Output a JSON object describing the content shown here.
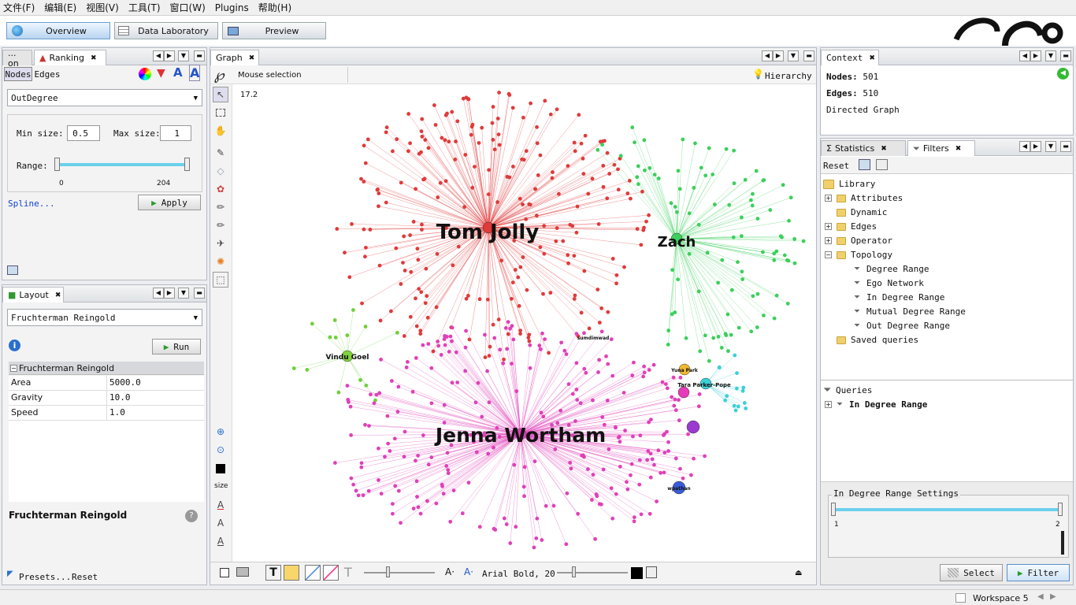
{
  "menu": [
    "文件(F)",
    "编辑(E)",
    "视图(V)",
    "工具(T)",
    "窗口(W)",
    "Plugins",
    "帮助(H)"
  ],
  "toolbar": {
    "overview": "Overview",
    "data_lab": "Data Laboratory",
    "preview": "Preview"
  },
  "ranking": {
    "tab_short": "... on",
    "tab": "Ranking",
    "nodes_tab": "Nodes",
    "edges_tab": "Edges",
    "metric": "OutDegree",
    "min_label": "Min size:",
    "min_value": "0.5",
    "max_label": "Max size:",
    "max_value": "1",
    "range_label": "Range:",
    "range_min": "0",
    "range_max": "204",
    "spline": "Spline...",
    "apply": "Apply"
  },
  "layout": {
    "tab": "Layout",
    "algorithm": "Fruchterman Reingold",
    "run": "Run",
    "section": "Fruchterman Reingold",
    "props": [
      {
        "k": "Area",
        "v": "5000.0"
      },
      {
        "k": "Gravity",
        "v": "10.0"
      },
      {
        "k": "Speed",
        "v": "1.0"
      }
    ],
    "desc_title": "Fruchterman Reingold",
    "presets": "Presets...",
    "reset": "Reset"
  },
  "graph": {
    "tab": "Graph",
    "mode": "Mouse selection",
    "hierarchy": "Hierarchy",
    "zoom": "17.2",
    "size_label": "size",
    "font": "Arial Bold, 20",
    "labels": {
      "tom": "Tom Jolly",
      "zach": "Zach",
      "vindu": "Vindu Goel",
      "jenna": "Jenna Wortham",
      "sumdimwad": "sumdimwad",
      "yuna": "Yuna Park",
      "tara": "Tara Parker-Pope",
      "wpathan": "wpathan"
    }
  },
  "context": {
    "tab": "Context",
    "nodes_label": "Nodes:",
    "nodes": "501",
    "edges_label": "Edges:",
    "edges": "510",
    "type": "Directed Graph"
  },
  "filters": {
    "stats_tab": "Statistics",
    "filters_tab": "Filters",
    "reset": "Reset",
    "library": "Library",
    "folders": [
      "Attributes",
      "Dynamic",
      "Edges",
      "Operator",
      "Topology"
    ],
    "topology": [
      "Degree Range",
      "Ego Network",
      "In Degree Range",
      "Mutual Degree Range",
      "Out Degree Range"
    ],
    "saved": "Saved queries",
    "queries": "Queries",
    "query_item": "In Degree Range",
    "settings_title": "In Degree Range Settings",
    "slider_min": "1",
    "slider_max": "2",
    "select": "Select",
    "filter": "Filter"
  },
  "status": {
    "workspace": "Workspace 5"
  }
}
